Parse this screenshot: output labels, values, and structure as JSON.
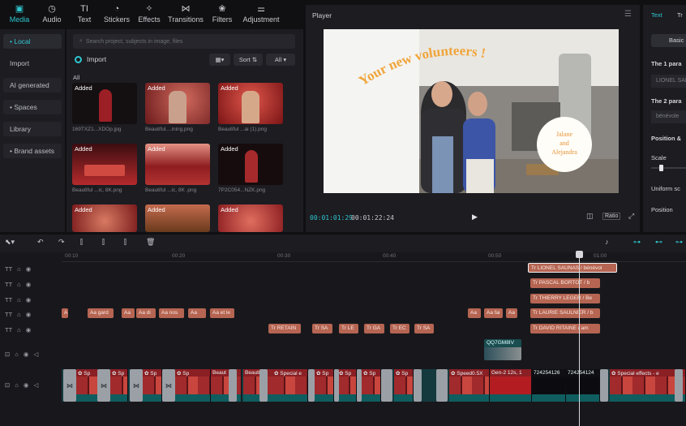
{
  "toolbar": {
    "items": [
      {
        "label": "Media",
        "icon": "media-icon"
      },
      {
        "label": "Audio",
        "icon": "audio-icon"
      },
      {
        "label": "Text",
        "icon": "text-icon"
      },
      {
        "label": "Stickers",
        "icon": "sticker-icon"
      },
      {
        "label": "Effects",
        "icon": "effects-icon"
      },
      {
        "label": "Transitions",
        "icon": "transitions-icon"
      },
      {
        "label": "Filters",
        "icon": "filters-icon"
      },
      {
        "label": "Adjustment",
        "icon": "adjustment-icon"
      }
    ],
    "active_color": "#2fc7cf"
  },
  "sidebar": {
    "items": [
      {
        "label": "• Local"
      },
      {
        "label": "Import"
      },
      {
        "label": "AI generated"
      },
      {
        "label": "• Spaces"
      },
      {
        "label": "Library"
      },
      {
        "label": "• Brand assets"
      }
    ]
  },
  "media": {
    "search_placeholder": "Search project, subjects in image, files",
    "import_label": "Import",
    "sort_label": "Sort",
    "filter_label": "All",
    "all_label": "All",
    "badge": "Added",
    "thumbs": [
      {
        "caption": "169TXZ1...XDOp.jpg"
      },
      {
        "caption": "Beautiful....ining.png"
      },
      {
        "caption": "Beautiful ...ai (1).png"
      },
      {
        "caption": "Beautiful ...ic, 8K.png"
      },
      {
        "caption": "Beautiful ...ic, 8K .png"
      },
      {
        "caption": "7P2C054...NZK.png"
      },
      {
        "caption": ""
      },
      {
        "caption": ""
      },
      {
        "caption": ""
      }
    ]
  },
  "player": {
    "title": "Player",
    "overlay_title": "Your new volunteers !",
    "names_line1": "Jalane",
    "names_line2": "and",
    "names_line3": "Alejandra",
    "time_current": "00:01:01:29",
    "time_total": "00:01:22:24",
    "ratio_label": "Ratio"
  },
  "right_panel": {
    "tab_text": "Text",
    "tab_tr": "Tr",
    "basic_label": "Basic",
    "para1_label": "The 1 para",
    "para1_value": "LIONEL SAL",
    "para2_label": "The 2 para",
    "para2_value": "bénévole",
    "position_label": "Position &",
    "scale_label": "Scale",
    "uniform_label": "Uniform sc",
    "position2_label": "Position"
  },
  "timeline": {
    "ruler": [
      "00:10",
      "00:20",
      "00:30",
      "00:40",
      "00:50",
      "01:00"
    ],
    "text_clips_row1": [
      {
        "label": "Tr LIONEL SAUNAS / bénévol"
      }
    ],
    "text_clips_row2": [
      {
        "label": "Tr PASCAL BORTOT / b"
      }
    ],
    "text_clips_row3": [
      {
        "label": "Tr THIERRY LEGER / Be"
      }
    ],
    "text_clips_row4": [
      {
        "label": "A"
      },
      {
        "label": "Aa gard"
      },
      {
        "label": "Aa"
      },
      {
        "label": "Aa di"
      },
      {
        "label": "Aa nos"
      },
      {
        "label": "Aa"
      },
      {
        "label": "Aa et le"
      },
      {
        "label": "Aa"
      },
      {
        "label": "Aa fai"
      },
      {
        "label": "Aa"
      },
      {
        "label": "Tr LAURIE SAULNIER / b"
      }
    ],
    "text_clips_row5": [
      {
        "label": "Tr RETAIN"
      },
      {
        "label": "Tr SA"
      },
      {
        "label": "Tr LE"
      },
      {
        "label": "Tr GA"
      },
      {
        "label": "Tr EC"
      },
      {
        "label": "Tr SA"
      },
      {
        "label": "Tr DAVID RITAINE / am"
      }
    ],
    "small_clip": "QQ7GM8IV",
    "video_clips": [
      {
        "label": "✿ Sp"
      },
      {
        "label": "✿ Sp"
      },
      {
        "label": "✿ Sp"
      },
      {
        "label": "✿ Sp"
      },
      {
        "label": "Beaut"
      },
      {
        "label": "Beautif"
      },
      {
        "label": "✿ Special e"
      },
      {
        "label": "✿ Sp"
      },
      {
        "label": "✿ Sp"
      },
      {
        "label": "✿ Sp"
      },
      {
        "label": "✿ Sp"
      },
      {
        "label": "✿ Speed0.5X"
      },
      {
        "label": "Gen-2 12s, 1"
      },
      {
        "label": "724254126"
      },
      {
        "label": "724254124"
      },
      {
        "label": "✿ Special effects - e"
      }
    ]
  }
}
